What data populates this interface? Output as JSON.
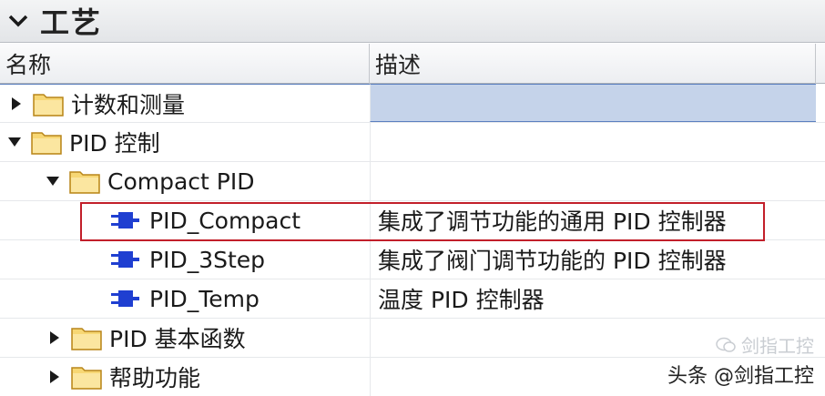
{
  "panel": {
    "title": "工艺"
  },
  "columns": {
    "name": "名称",
    "description": "描述"
  },
  "rows": [
    {
      "label": "计数和测量",
      "description": "",
      "type": "folder",
      "level": 0,
      "expanded": false,
      "selected": true
    },
    {
      "label": "PID 控制",
      "description": "",
      "type": "folder",
      "level": 0,
      "expanded": true
    },
    {
      "label": "Compact PID",
      "description": "",
      "type": "folder",
      "level": 1,
      "expanded": true
    },
    {
      "label": "PID_Compact",
      "description": "集成了调节功能的通用 PID 控制器",
      "type": "block",
      "level": 2,
      "highlighted": true
    },
    {
      "label": "PID_3Step",
      "description": "集成了阀门调节功能的 PID 控制器",
      "type": "block",
      "level": 2
    },
    {
      "label": "PID_Temp",
      "description": "温度 PID 控制器",
      "type": "block",
      "level": 2
    },
    {
      "label": "PID 基本函数",
      "description": "",
      "type": "folder",
      "level": 1,
      "expanded": false
    },
    {
      "label": "帮助功能",
      "description": "",
      "type": "folder",
      "level": 1,
      "expanded": false
    }
  ],
  "watermark": {
    "faint": "剑指工控",
    "main": "头条 @剑指工控"
  },
  "colors": {
    "selected_row": "#c5d3ea",
    "highlight_border": "#c21f2a",
    "folder": "#f2c14e",
    "block_icon": "#1f3fd1"
  },
  "icons": {
    "collapse": "chevron-down-icon",
    "folder": "folder-icon",
    "block": "function-block-icon"
  }
}
